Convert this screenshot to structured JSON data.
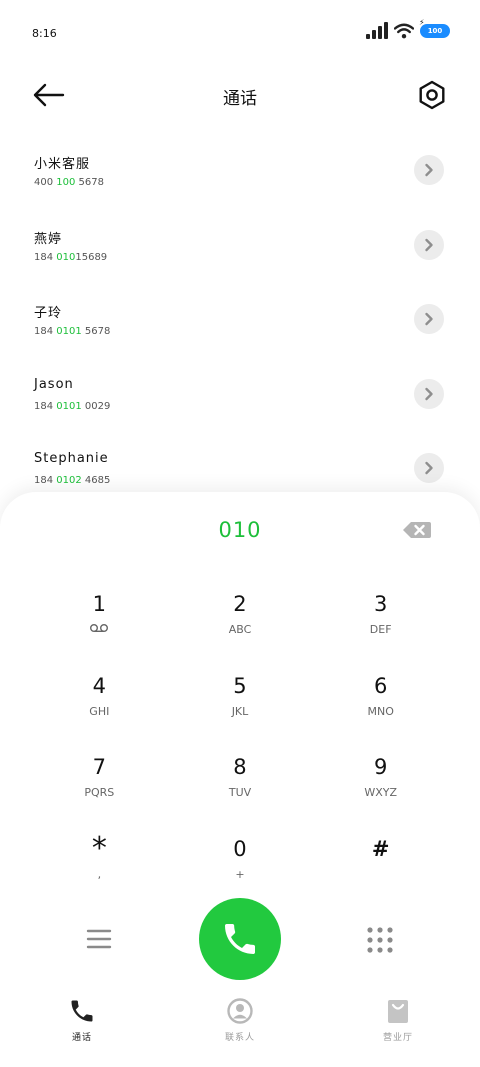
{
  "status_bar": {
    "time": "8:16",
    "battery": "100"
  },
  "header": {
    "title": "通话"
  },
  "contacts": [
    {
      "name": "小米客服",
      "number_pre": "400 ",
      "number_hl": "100",
      "number_post": " 5678"
    },
    {
      "name": "燕婷",
      "number_pre": "184 ",
      "number_hl": "010",
      "number_post": "15689"
    },
    {
      "name": "子玲",
      "number_pre": "184 ",
      "number_hl": "0101",
      "number_post": " 5678"
    },
    {
      "name": "Jason",
      "number_pre": "184 ",
      "number_hl": "0101",
      "number_post": " 0029"
    },
    {
      "name": "Stephanie",
      "number_pre": "184 ",
      "number_hl": "0102",
      "number_post": " 4685"
    }
  ],
  "dialpad": {
    "input": "010",
    "keys": [
      {
        "digit": "1",
        "letters": ""
      },
      {
        "digit": "2",
        "letters": "ABC"
      },
      {
        "digit": "3",
        "letters": "DEF"
      },
      {
        "digit": "4",
        "letters": "GHI"
      },
      {
        "digit": "5",
        "letters": "JKL"
      },
      {
        "digit": "6",
        "letters": "MNO"
      },
      {
        "digit": "7",
        "letters": "PQRS"
      },
      {
        "digit": "8",
        "letters": "TUV"
      },
      {
        "digit": "9",
        "letters": "WXYZ"
      },
      {
        "digit": "*",
        "letters": ","
      },
      {
        "digit": "0",
        "letters": "+"
      },
      {
        "digit": "#",
        "letters": ""
      }
    ]
  },
  "tabs": [
    {
      "label": "通话",
      "icon": "phone-icon",
      "active": true
    },
    {
      "label": "联系人",
      "icon": "contacts-icon",
      "active": false
    },
    {
      "label": "营业厅",
      "icon": "store-bag-icon",
      "active": false
    }
  ],
  "colors": {
    "accent": "#1dbf3a",
    "call_button": "#22c93f",
    "battery": "#1a8cff"
  }
}
